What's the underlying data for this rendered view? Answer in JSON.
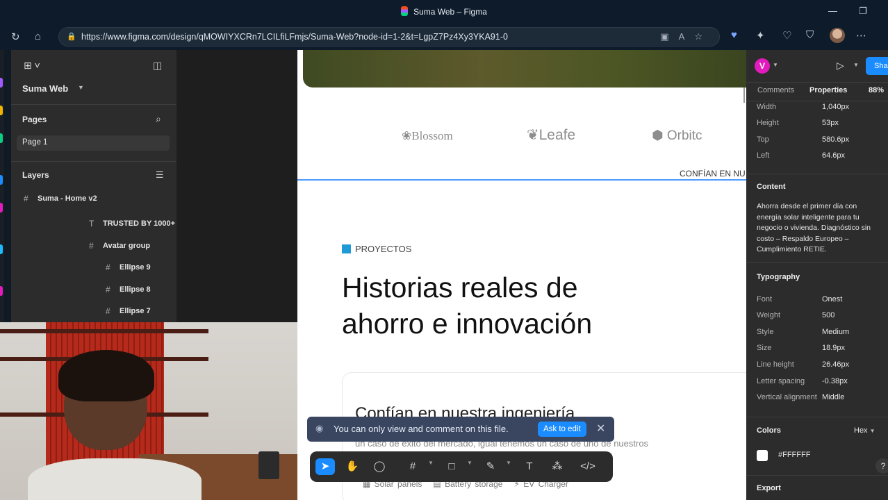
{
  "browser": {
    "window_title": "Suma Web – Figma",
    "url": "https://www.figma.com/design/qMOWIYXCRn7LCILfiLFmjs/Suma-Web?node-id=1-2&t=LgpZ7Pz4Xy3YKA91-0"
  },
  "left_panel": {
    "file_name": "Suma Web",
    "pages_label": "Pages",
    "current_page": "Page 1",
    "layers_label": "Layers",
    "layers": [
      {
        "label": "Suma - Home v2",
        "icon": "frame-icon"
      },
      {
        "label": "TRUSTED BY 1000+",
        "icon": "text-icon"
      },
      {
        "label": "Avatar group",
        "icon": "frame-icon"
      },
      {
        "label": "Ellipse 9",
        "icon": "frame-icon"
      },
      {
        "label": "Ellipse 8",
        "icon": "frame-icon"
      },
      {
        "label": "Ellipse 7",
        "icon": "frame-icon"
      }
    ]
  },
  "canvas": {
    "logos": [
      "Blossom",
      "Leafe",
      "Orbitc"
    ],
    "trust_text": "CONFÍAN EN NU",
    "tag": "PROYECTOS",
    "heading_line1": "Historias reales de",
    "heading_line2": "ahorro e innovación",
    "card_title": "Confían en nuestra ingeniería",
    "card_text": "un caso de éxito del mercado, igual tenemos un caso de uno de nuestros",
    "chips": [
      "Solar panels",
      "Battery storage",
      "EV Charger"
    ]
  },
  "toast": {
    "message": "You can only view and comment on this file.",
    "ask_label": "Ask to edit"
  },
  "right_panel": {
    "avatar_letter": "V",
    "share_label": "Sha",
    "tabs": {
      "comments": "Comments",
      "properties": "Properties",
      "zoom": "88%"
    },
    "dimensions": [
      {
        "label": "Width",
        "value": "1,040px"
      },
      {
        "label": "Height",
        "value": "53px"
      },
      {
        "label": "Top",
        "value": "580.6px"
      },
      {
        "label": "Left",
        "value": "64.6px"
      }
    ],
    "content_label": "Content",
    "content_text": [
      "Ahorra desde el primer día con",
      "energía solar inteligente para tu",
      "negocio o vivienda. Diagnóstico sin",
      "costo – Respaldo Europeo –",
      "Cumplimiento RETIE."
    ],
    "typography_label": "Typography",
    "typography": [
      {
        "label": "Font",
        "value": "Onest"
      },
      {
        "label": "Weight",
        "value": "500"
      },
      {
        "label": "Style",
        "value": "Medium"
      },
      {
        "label": "Size",
        "value": "18.9px"
      },
      {
        "label": "Line height",
        "value": "26.46px"
      },
      {
        "label": "Letter spacing",
        "value": "-0.38px"
      },
      {
        "label": "Vertical alignment",
        "value": "Middle"
      }
    ],
    "colors_label": "Colors",
    "color_format": "Hex",
    "color_value": "#FFFFFF",
    "export_label": "Export",
    "help_label": "?"
  },
  "colors": {
    "accent": "#1a8cff",
    "tag_square": "#1e9bd7",
    "avatar": "#e21bbd"
  }
}
